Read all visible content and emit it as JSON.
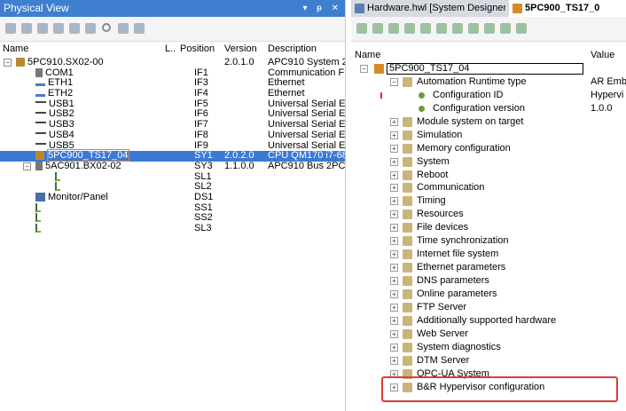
{
  "physical_view": {
    "title": "Physical View",
    "controls": "▾ ᵽ ✕",
    "columns": {
      "name": "Name",
      "l": "L..",
      "position": "Position",
      "version": "Version",
      "description": "Description"
    },
    "rows": [
      {
        "name": "5PC910.SX02-00",
        "position": "",
        "version": "2.0.1.0",
        "description": "APC910 System 2",
        "icon": "cpu-icon",
        "indent": 0,
        "expand": "⊟"
      },
      {
        "name": "COM1",
        "position": "IF1",
        "version": "",
        "description": "Communication F",
        "icon": "serial-icon",
        "indent": 1,
        "expand": ""
      },
      {
        "name": "ETH1",
        "position": "IF3",
        "version": "",
        "description": "Ethernet",
        "icon": "ethernet-icon",
        "indent": 1,
        "expand": ""
      },
      {
        "name": "ETH2",
        "position": "IF4",
        "version": "",
        "description": "Ethernet",
        "icon": "ethernet-icon",
        "indent": 1,
        "expand": ""
      },
      {
        "name": "USB1",
        "position": "IF5",
        "version": "",
        "description": "Universal Serial E",
        "icon": "usb-icon",
        "indent": 1,
        "expand": ""
      },
      {
        "name": "USB2",
        "position": "IF6",
        "version": "",
        "description": "Universal Serial E",
        "icon": "usb-icon",
        "indent": 1,
        "expand": ""
      },
      {
        "name": "USB3",
        "position": "IF7",
        "version": "",
        "description": "Universal Serial E",
        "icon": "usb-icon",
        "indent": 1,
        "expand": ""
      },
      {
        "name": "USB4",
        "position": "IF8",
        "version": "",
        "description": "Universal Serial E",
        "icon": "usb-icon",
        "indent": 1,
        "expand": ""
      },
      {
        "name": "USB5",
        "position": "IF9",
        "version": "",
        "description": "Universal Serial E",
        "icon": "usb-icon",
        "indent": 1,
        "expand": ""
      },
      {
        "name": "5PC900_TS17_04",
        "position": "SY1",
        "version": "2.0.2.0",
        "description": "CPU QM170 i7-68",
        "icon": "cpu-icon",
        "indent": 1,
        "expand": "",
        "selected": true
      },
      {
        "name": "5AC901.BX02-02",
        "position": "SY3",
        "version": "1.1.0.0",
        "description": "APC910 Bus 2PC",
        "icon": "bus-icon",
        "indent": 1,
        "expand": "⊟"
      },
      {
        "name": "",
        "position": "SL1",
        "version": "",
        "description": "",
        "icon": "slot-icon",
        "indent": 2,
        "expand": ""
      },
      {
        "name": "",
        "position": "SL2",
        "version": "",
        "description": "",
        "icon": "slot-icon",
        "indent": 2,
        "expand": ""
      },
      {
        "name": "Monitor/Panel",
        "position": "DS1",
        "version": "",
        "description": "",
        "icon": "monitor-icon",
        "indent": 1,
        "expand": ""
      },
      {
        "name": "",
        "position": "SS1",
        "version": "",
        "description": "",
        "icon": "slot-icon",
        "indent": 1,
        "expand": ""
      },
      {
        "name": "",
        "position": "SS2",
        "version": "",
        "description": "",
        "icon": "slot-icon",
        "indent": 1,
        "expand": ""
      },
      {
        "name": "",
        "position": "SL3",
        "version": "",
        "description": "",
        "icon": "slot-icon",
        "indent": 1,
        "expand": ""
      }
    ]
  },
  "editor": {
    "tabs": [
      {
        "label": "Hardware.hwl [System Designer]",
        "active": false
      },
      {
        "label": "5PC900_TS17_0",
        "active": true
      }
    ],
    "columns": {
      "name": "Name",
      "value": "Value"
    },
    "root": "5PC900_TS17_04",
    "rows": [
      {
        "label": "Automation Runtime type",
        "value": "AR Emb",
        "icon": "config-icon",
        "expand": "⊟",
        "level": 1
      },
      {
        "label": "Configuration ID",
        "value": "Hypervi",
        "icon": "param-icon",
        "expand": "",
        "level": 2,
        "marker": true
      },
      {
        "label": "Configuration version",
        "value": "1.0.0",
        "icon": "param-icon",
        "expand": "",
        "level": 2
      },
      {
        "label": "Module system on target",
        "value": "",
        "icon": "config-icon",
        "expand": "⊞",
        "level": 1
      },
      {
        "label": "Simulation",
        "value": "",
        "icon": "config-icon",
        "expand": "⊞",
        "level": 1
      },
      {
        "label": "Memory configuration",
        "value": "",
        "icon": "config-icon",
        "expand": "⊞",
        "level": 1
      },
      {
        "label": "System",
        "value": "",
        "icon": "config-icon",
        "expand": "⊞",
        "level": 1
      },
      {
        "label": "Reboot",
        "value": "",
        "icon": "config-icon",
        "expand": "⊞",
        "level": 1
      },
      {
        "label": "Communication",
        "value": "",
        "icon": "config-icon",
        "expand": "⊞",
        "level": 1
      },
      {
        "label": "Timing",
        "value": "",
        "icon": "config-icon",
        "expand": "⊞",
        "level": 1
      },
      {
        "label": "Resources",
        "value": "",
        "icon": "config-icon",
        "expand": "⊞",
        "level": 1
      },
      {
        "label": "File devices",
        "value": "",
        "icon": "config-icon",
        "expand": "⊞",
        "level": 1
      },
      {
        "label": "Time synchronization",
        "value": "",
        "icon": "config-icon",
        "expand": "⊞",
        "level": 1
      },
      {
        "label": "Internet file system",
        "value": "",
        "icon": "config-icon",
        "expand": "⊞",
        "level": 1
      },
      {
        "label": "Ethernet parameters",
        "value": "",
        "icon": "config-icon",
        "expand": "⊞",
        "level": 1
      },
      {
        "label": "DNS parameters",
        "value": "",
        "icon": "config-icon",
        "expand": "⊞",
        "level": 1
      },
      {
        "label": "Online parameters",
        "value": "",
        "icon": "config-icon",
        "expand": "⊞",
        "level": 1
      },
      {
        "label": "FTP Server",
        "value": "",
        "icon": "config-icon",
        "expand": "⊞",
        "level": 1
      },
      {
        "label": "Additionally supported hardware",
        "value": "",
        "icon": "config-icon",
        "expand": "⊞",
        "level": 1
      },
      {
        "label": "Web Server",
        "value": "",
        "icon": "config-icon",
        "expand": "⊞",
        "level": 1
      },
      {
        "label": "System diagnostics",
        "value": "",
        "icon": "config-icon",
        "expand": "⊞",
        "level": 1
      },
      {
        "label": "DTM Server",
        "value": "",
        "icon": "config-icon",
        "expand": "⊞",
        "level": 1
      },
      {
        "label": "OPC-UA System",
        "value": "",
        "icon": "config-icon",
        "expand": "⊞",
        "level": 1
      },
      {
        "label": "B&R Hypervisor configuration",
        "value": "",
        "icon": "config-icon",
        "expand": "⊞",
        "level": 1
      }
    ]
  },
  "colors": {
    "title_bar": "#3e7fd0",
    "selection": "#3b79d4",
    "highlight": "#e23b33"
  }
}
